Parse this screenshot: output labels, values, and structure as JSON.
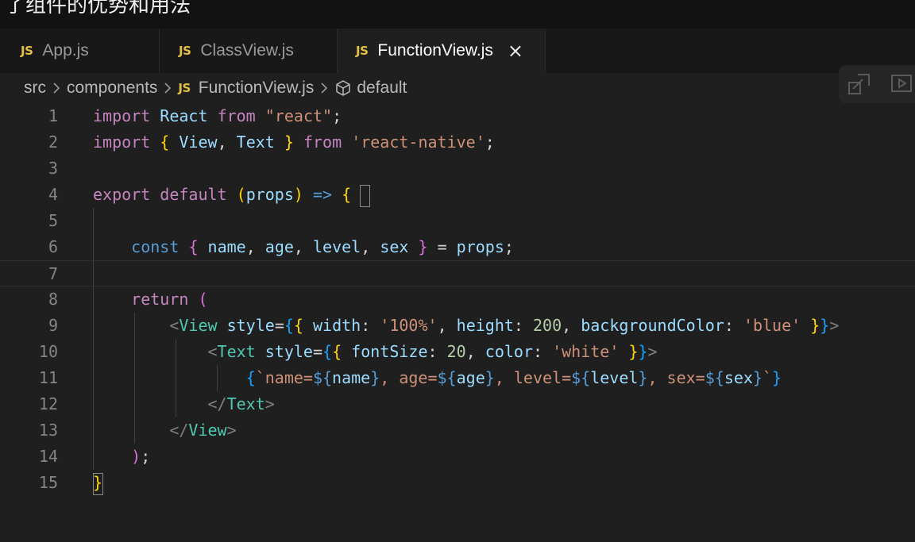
{
  "top_strip": {
    "text": "了组件的优势和用法"
  },
  "tabs": [
    {
      "lang": "JS",
      "label": "App.js",
      "active": false
    },
    {
      "lang": "JS",
      "label": "ClassView.js",
      "active": false
    },
    {
      "lang": "JS",
      "label": "FunctionView.js",
      "active": true
    }
  ],
  "breadcrumb": {
    "items": [
      "src",
      "components",
      "FunctionView.js",
      "default"
    ],
    "lang": "JS"
  },
  "editor": {
    "current_line": 7,
    "line_numbers": [
      "1",
      "2",
      "3",
      "4",
      "5",
      "6",
      "7",
      "8",
      "9",
      "10",
      "11",
      "12",
      "13",
      "14",
      "15"
    ]
  },
  "colors": {
    "background": "#1f1f1f",
    "tab_inactive": "#181818",
    "js_badge": "#e2c044",
    "keyword": "#c586c0",
    "storage": "#569cd6",
    "variable": "#9cdcfe",
    "string": "#ce9178",
    "number": "#b5cea8",
    "tag": "#4ec9b0"
  },
  "icons": [
    "close-icon",
    "chevron-right-icon",
    "cube-icon",
    "split-editor-icon",
    "run-preview-icon"
  ]
}
